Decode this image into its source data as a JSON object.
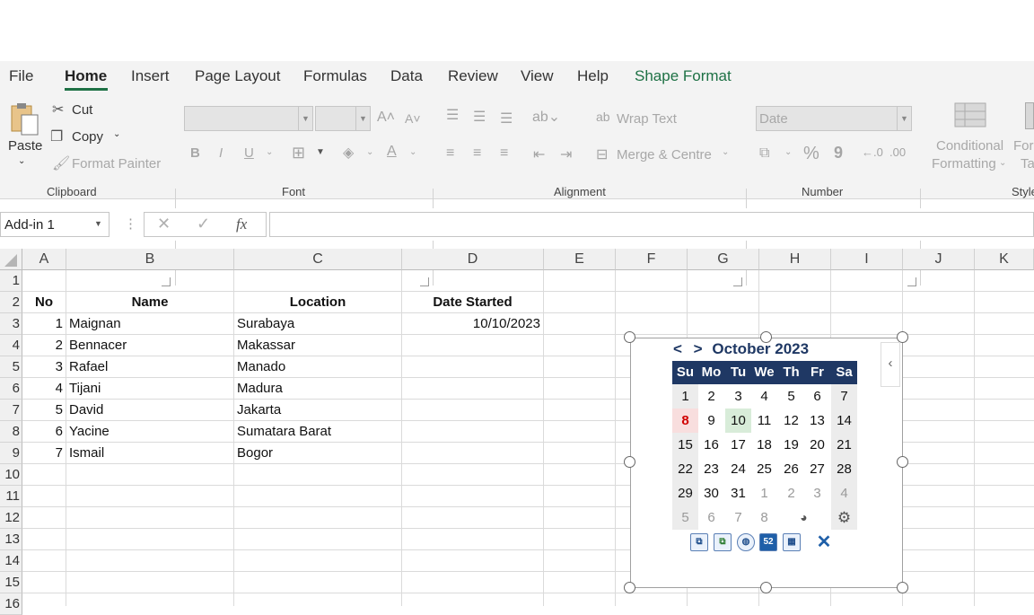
{
  "tabs": [
    "File",
    "Home",
    "Insert",
    "Page Layout",
    "Formulas",
    "Data",
    "Review",
    "View",
    "Help",
    "Shape Format"
  ],
  "ribbon": {
    "clipboard": {
      "paste": "Paste",
      "cut": "Cut",
      "copy": "Copy",
      "format_painter": "Format Painter",
      "group": "Clipboard"
    },
    "font": {
      "group": "Font",
      "bold": "B",
      "italic": "I",
      "underline": "U"
    },
    "alignment": {
      "wrap_text": "Wrap Text",
      "merge": "Merge & Centre",
      "group": "Alignment"
    },
    "number": {
      "format": "Date",
      "group": "Number",
      "percent": "%",
      "comma": "9"
    },
    "styles": {
      "conditional_line1": "Conditional",
      "conditional_line2": "Formatting",
      "format_as_line1": "For",
      "format_as_line2": "Ta",
      "group": "Style"
    }
  },
  "formula_bar": {
    "name_box": "Add-in 1",
    "fx": "fx",
    "formula": ""
  },
  "columns": [
    "A",
    "B",
    "C",
    "D",
    "E",
    "F",
    "G",
    "H",
    "I",
    "J",
    "K"
  ],
  "rows": [
    "1",
    "2",
    "3",
    "4",
    "5",
    "6",
    "7",
    "8",
    "9",
    "10",
    "11",
    "12",
    "13",
    "14",
    "15",
    "16"
  ],
  "table": {
    "headers": {
      "no": "No",
      "name": "Name",
      "location": "Location",
      "date": "Date Started"
    },
    "records": [
      {
        "no": "1",
        "name": "Maignan",
        "location": "Surabaya",
        "date": "10/10/2023"
      },
      {
        "no": "2",
        "name": "Bennacer",
        "location": "Makassar",
        "date": ""
      },
      {
        "no": "3",
        "name": "Rafael",
        "location": "Manado",
        "date": ""
      },
      {
        "no": "4",
        "name": "Tijani",
        "location": "Madura",
        "date": ""
      },
      {
        "no": "5",
        "name": "David",
        "location": "Jakarta",
        "date": ""
      },
      {
        "no": "6",
        "name": "Yacine",
        "location": "Sumatara Barat",
        "date": ""
      },
      {
        "no": "7",
        "name": "Ismail",
        "location": "Bogor",
        "date": ""
      }
    ]
  },
  "calendar": {
    "prev": "<",
    "next": ">",
    "month_label": "October 2023",
    "weekdays": [
      "Su",
      "Mo",
      "Tu",
      "We",
      "Th",
      "Fr",
      "Sa"
    ],
    "weeks": [
      [
        "1",
        "2",
        "3",
        "4",
        "5",
        "6",
        "7"
      ],
      [
        "8",
        "9",
        "10",
        "11",
        "12",
        "13",
        "14"
      ],
      [
        "15",
        "16",
        "17",
        "18",
        "19",
        "20",
        "21"
      ],
      [
        "22",
        "23",
        "24",
        "25",
        "26",
        "27",
        "28"
      ],
      [
        "29",
        "30",
        "31",
        "1",
        "2",
        "3",
        "4"
      ],
      [
        "5",
        "6",
        "7",
        "8",
        "",
        "",
        ""
      ]
    ],
    "today": "8",
    "selected": "10",
    "colors": {
      "header": "#1f3864",
      "today": "#d00000",
      "selected": "#d8ecd9"
    },
    "collapse_icon": "chevron-left-icon",
    "tools": [
      "window-restore-icon",
      "window-copy-icon",
      "globe-icon",
      "week-number-icon",
      "calendar-grid-icon",
      "close-icon"
    ],
    "tool_labels": {
      "week": "52"
    }
  },
  "accent": "#1e7145"
}
